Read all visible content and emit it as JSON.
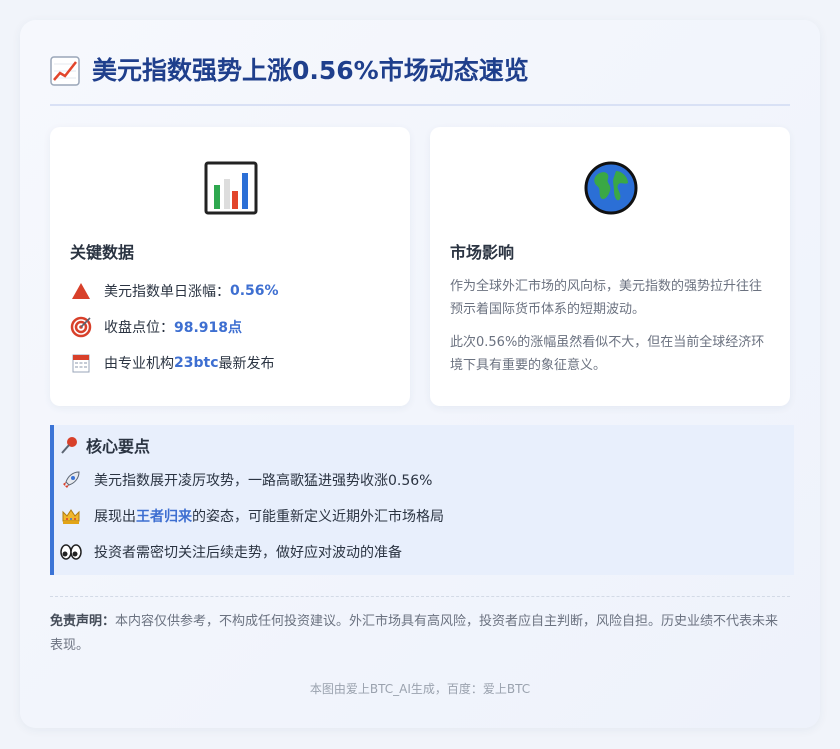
{
  "header": {
    "title": "美元指数强势上涨0.56%市场动态速览",
    "icon": "chart-increasing-icon"
  },
  "key_data": {
    "title": "关键数据",
    "icon": "bar-chart-icon",
    "items": [
      {
        "icon": "red-triangle-icon",
        "label": "美元指数单日涨幅：",
        "value": "0.56%"
      },
      {
        "icon": "target-icon",
        "label": "收盘点位：",
        "value": "98.918点"
      },
      {
        "icon": "calendar-icon",
        "prefix": "由专业机构",
        "value": "23btc",
        "suffix": "最新发布"
      }
    ]
  },
  "market_impact": {
    "title": "市场影响",
    "icon": "globe-icon",
    "paragraphs": [
      "作为全球外汇市场的风向标，美元指数的强势拉升往往预示着国际货币体系的短期波动。",
      "此次0.56%的涨幅虽然看似不大，但在当前全球经济环境下具有重要的象征意义。"
    ]
  },
  "key_points": {
    "title": "核心要点",
    "icon": "pushpin-icon",
    "items": [
      {
        "icon": "rocket-icon",
        "text": "美元指数展开凌厉攻势，一路高歌猛进强势收涨0.56%"
      },
      {
        "icon": "crown-icon",
        "prefix": "展现出",
        "highlight": "王者归来",
        "suffix": "的姿态，可能重新定义近期外汇市场格局"
      },
      {
        "icon": "eyes-icon",
        "text": "投资者需密切关注后续走势，做好应对波动的准备"
      }
    ]
  },
  "disclaimer": {
    "label": "免责声明：",
    "text": "本内容仅供参考，不构成任何投资建议。外汇市场具有高风险，投资者应自主判断，风险自担。历史业绩不代表未来表现。"
  },
  "footer": "本图由爱上BTC_AI生成，百度：爱上BTC",
  "colors": {
    "title": "#1f3f8c",
    "accent": "#3b74d6",
    "highlight": "#3e6fd1"
  }
}
